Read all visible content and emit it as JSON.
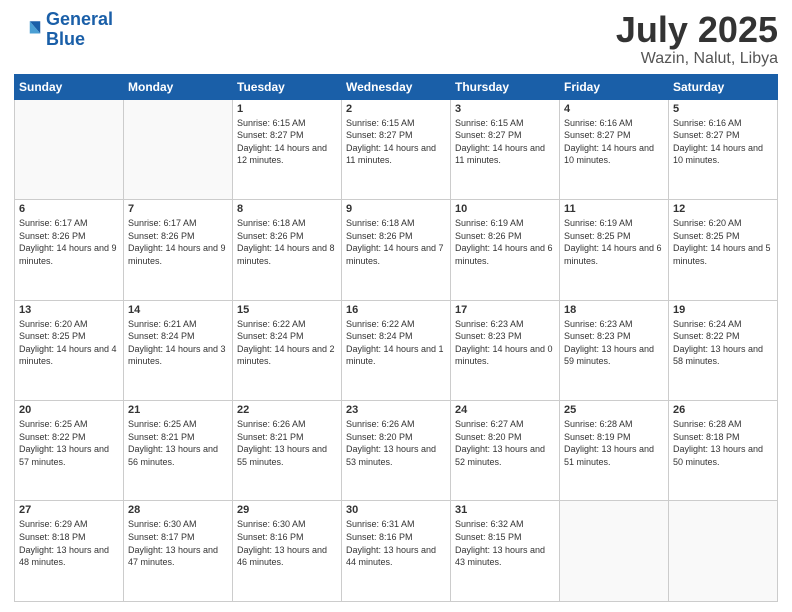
{
  "logo": {
    "line1": "General",
    "line2": "Blue"
  },
  "header": {
    "month": "July 2025",
    "location": "Wazin, Nalut, Libya"
  },
  "weekdays": [
    "Sunday",
    "Monday",
    "Tuesday",
    "Wednesday",
    "Thursday",
    "Friday",
    "Saturday"
  ],
  "weeks": [
    [
      {
        "day": null
      },
      {
        "day": null
      },
      {
        "day": "1",
        "sunrise": "Sunrise: 6:15 AM",
        "sunset": "Sunset: 8:27 PM",
        "daylight": "Daylight: 14 hours and 12 minutes."
      },
      {
        "day": "2",
        "sunrise": "Sunrise: 6:15 AM",
        "sunset": "Sunset: 8:27 PM",
        "daylight": "Daylight: 14 hours and 11 minutes."
      },
      {
        "day": "3",
        "sunrise": "Sunrise: 6:15 AM",
        "sunset": "Sunset: 8:27 PM",
        "daylight": "Daylight: 14 hours and 11 minutes."
      },
      {
        "day": "4",
        "sunrise": "Sunrise: 6:16 AM",
        "sunset": "Sunset: 8:27 PM",
        "daylight": "Daylight: 14 hours and 10 minutes."
      },
      {
        "day": "5",
        "sunrise": "Sunrise: 6:16 AM",
        "sunset": "Sunset: 8:27 PM",
        "daylight": "Daylight: 14 hours and 10 minutes."
      }
    ],
    [
      {
        "day": "6",
        "sunrise": "Sunrise: 6:17 AM",
        "sunset": "Sunset: 8:26 PM",
        "daylight": "Daylight: 14 hours and 9 minutes."
      },
      {
        "day": "7",
        "sunrise": "Sunrise: 6:17 AM",
        "sunset": "Sunset: 8:26 PM",
        "daylight": "Daylight: 14 hours and 9 minutes."
      },
      {
        "day": "8",
        "sunrise": "Sunrise: 6:18 AM",
        "sunset": "Sunset: 8:26 PM",
        "daylight": "Daylight: 14 hours and 8 minutes."
      },
      {
        "day": "9",
        "sunrise": "Sunrise: 6:18 AM",
        "sunset": "Sunset: 8:26 PM",
        "daylight": "Daylight: 14 hours and 7 minutes."
      },
      {
        "day": "10",
        "sunrise": "Sunrise: 6:19 AM",
        "sunset": "Sunset: 8:26 PM",
        "daylight": "Daylight: 14 hours and 6 minutes."
      },
      {
        "day": "11",
        "sunrise": "Sunrise: 6:19 AM",
        "sunset": "Sunset: 8:25 PM",
        "daylight": "Daylight: 14 hours and 6 minutes."
      },
      {
        "day": "12",
        "sunrise": "Sunrise: 6:20 AM",
        "sunset": "Sunset: 8:25 PM",
        "daylight": "Daylight: 14 hours and 5 minutes."
      }
    ],
    [
      {
        "day": "13",
        "sunrise": "Sunrise: 6:20 AM",
        "sunset": "Sunset: 8:25 PM",
        "daylight": "Daylight: 14 hours and 4 minutes."
      },
      {
        "day": "14",
        "sunrise": "Sunrise: 6:21 AM",
        "sunset": "Sunset: 8:24 PM",
        "daylight": "Daylight: 14 hours and 3 minutes."
      },
      {
        "day": "15",
        "sunrise": "Sunrise: 6:22 AM",
        "sunset": "Sunset: 8:24 PM",
        "daylight": "Daylight: 14 hours and 2 minutes."
      },
      {
        "day": "16",
        "sunrise": "Sunrise: 6:22 AM",
        "sunset": "Sunset: 8:24 PM",
        "daylight": "Daylight: 14 hours and 1 minute."
      },
      {
        "day": "17",
        "sunrise": "Sunrise: 6:23 AM",
        "sunset": "Sunset: 8:23 PM",
        "daylight": "Daylight: 14 hours and 0 minutes."
      },
      {
        "day": "18",
        "sunrise": "Sunrise: 6:23 AM",
        "sunset": "Sunset: 8:23 PM",
        "daylight": "Daylight: 13 hours and 59 minutes."
      },
      {
        "day": "19",
        "sunrise": "Sunrise: 6:24 AM",
        "sunset": "Sunset: 8:22 PM",
        "daylight": "Daylight: 13 hours and 58 minutes."
      }
    ],
    [
      {
        "day": "20",
        "sunrise": "Sunrise: 6:25 AM",
        "sunset": "Sunset: 8:22 PM",
        "daylight": "Daylight: 13 hours and 57 minutes."
      },
      {
        "day": "21",
        "sunrise": "Sunrise: 6:25 AM",
        "sunset": "Sunset: 8:21 PM",
        "daylight": "Daylight: 13 hours and 56 minutes."
      },
      {
        "day": "22",
        "sunrise": "Sunrise: 6:26 AM",
        "sunset": "Sunset: 8:21 PM",
        "daylight": "Daylight: 13 hours and 55 minutes."
      },
      {
        "day": "23",
        "sunrise": "Sunrise: 6:26 AM",
        "sunset": "Sunset: 8:20 PM",
        "daylight": "Daylight: 13 hours and 53 minutes."
      },
      {
        "day": "24",
        "sunrise": "Sunrise: 6:27 AM",
        "sunset": "Sunset: 8:20 PM",
        "daylight": "Daylight: 13 hours and 52 minutes."
      },
      {
        "day": "25",
        "sunrise": "Sunrise: 6:28 AM",
        "sunset": "Sunset: 8:19 PM",
        "daylight": "Daylight: 13 hours and 51 minutes."
      },
      {
        "day": "26",
        "sunrise": "Sunrise: 6:28 AM",
        "sunset": "Sunset: 8:18 PM",
        "daylight": "Daylight: 13 hours and 50 minutes."
      }
    ],
    [
      {
        "day": "27",
        "sunrise": "Sunrise: 6:29 AM",
        "sunset": "Sunset: 8:18 PM",
        "daylight": "Daylight: 13 hours and 48 minutes."
      },
      {
        "day": "28",
        "sunrise": "Sunrise: 6:30 AM",
        "sunset": "Sunset: 8:17 PM",
        "daylight": "Daylight: 13 hours and 47 minutes."
      },
      {
        "day": "29",
        "sunrise": "Sunrise: 6:30 AM",
        "sunset": "Sunset: 8:16 PM",
        "daylight": "Daylight: 13 hours and 46 minutes."
      },
      {
        "day": "30",
        "sunrise": "Sunrise: 6:31 AM",
        "sunset": "Sunset: 8:16 PM",
        "daylight": "Daylight: 13 hours and 44 minutes."
      },
      {
        "day": "31",
        "sunrise": "Sunrise: 6:32 AM",
        "sunset": "Sunset: 8:15 PM",
        "daylight": "Daylight: 13 hours and 43 minutes."
      },
      {
        "day": null
      },
      {
        "day": null
      }
    ]
  ]
}
